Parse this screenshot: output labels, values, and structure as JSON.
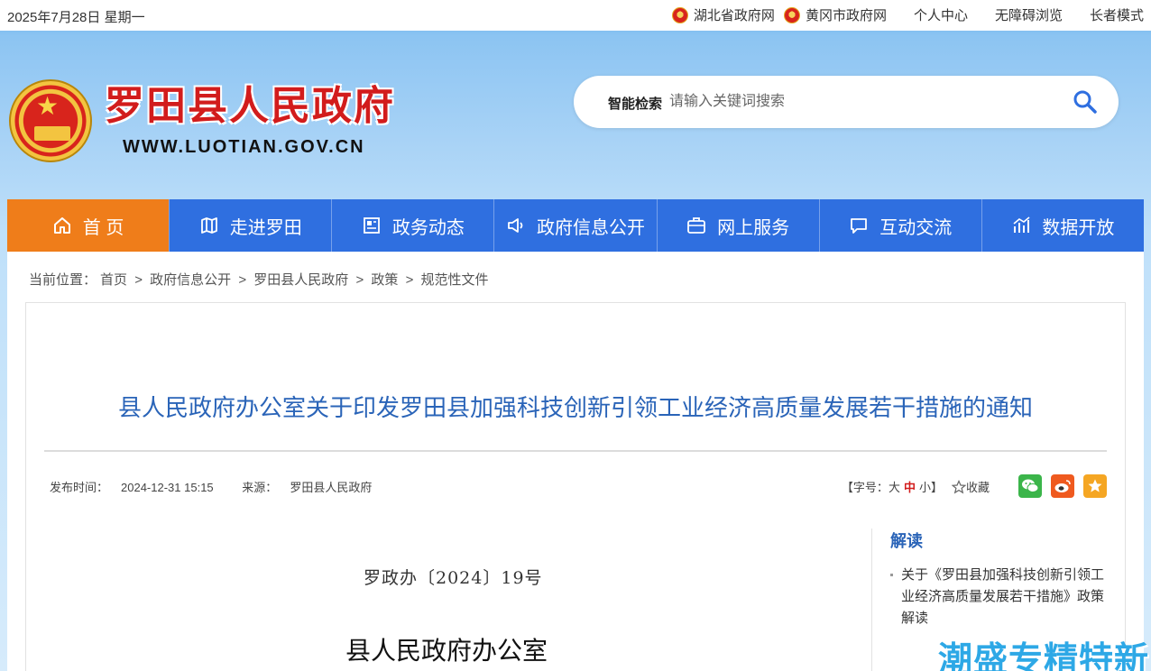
{
  "topbar": {
    "date": "2025年7月28日 星期一",
    "links": [
      "湖北省政府网",
      "黄冈市政府网",
      "个人中心",
      "无障碍浏览",
      "长者模式"
    ]
  },
  "header": {
    "site_name": "罗田县人民政府",
    "site_url": "WWW.LUOTIAN.GOV.CN",
    "search_label": "智能检索",
    "search_placeholder": "请输入关键词搜索",
    "search_icon": "search-icon"
  },
  "nav": {
    "items": [
      {
        "label": "首 页",
        "icon": "home-icon"
      },
      {
        "label": "走进罗田",
        "icon": "map-icon"
      },
      {
        "label": "政务动态",
        "icon": "news-icon"
      },
      {
        "label": "政府信息公开",
        "icon": "speaker-icon"
      },
      {
        "label": "网上服务",
        "icon": "briefcase-icon"
      },
      {
        "label": "互动交流",
        "icon": "chat-icon"
      },
      {
        "label": "数据开放",
        "icon": "chart-icon"
      }
    ],
    "active_color": "#ef7d1a",
    "bar_color": "#2f6fe0"
  },
  "breadcrumb": {
    "prefix": "当前位置：",
    "items": [
      "首页",
      "政府信息公开",
      "罗田县人民政府",
      "政策",
      "规范性文件"
    ]
  },
  "article": {
    "title": "县人民政府办公室关于印发罗田县加强科技创新引领工业经济高质量发展若干措施的通知",
    "publish_label": "发布时间：",
    "publish_time": "2024-12-31 15:15",
    "source_label": "来源：",
    "source": "罗田县人民政府",
    "font_label": "【字号：",
    "font_large": "大",
    "font_mid": "中",
    "font_small": "小】",
    "favorite": "收藏",
    "doc_number": "罗政办〔2024〕19号",
    "issuer": "县人民政府办公室"
  },
  "sidebar": {
    "heading": "解读",
    "items": [
      "关于《罗田县加强科技创新引领工业经济高质量发展若干措施》政策解读"
    ]
  },
  "watermark": "潮盛专精特新"
}
